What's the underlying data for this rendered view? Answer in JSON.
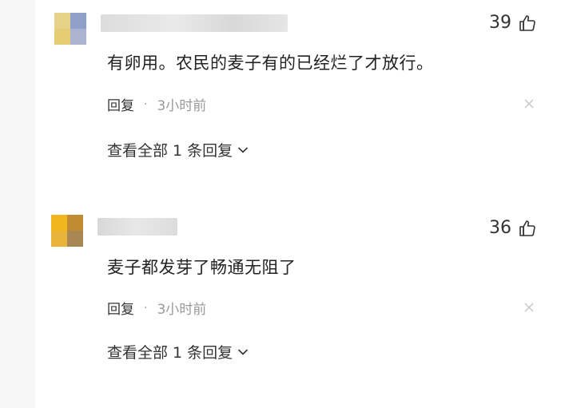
{
  "comments": [
    {
      "likes": "39",
      "text": "有卵用。农民的麦子有的已经烂了才放行。",
      "reply_label": "回复",
      "separator": "·",
      "time": "3小时前",
      "view_all": "查看全部 1 条回复",
      "avatar_colors": [
        "#e8d28a",
        "#8fa0c8",
        "#e5cd73",
        "#aab4cf"
      ]
    },
    {
      "likes": "36",
      "text": "麦子都发芽了畅通无阻了",
      "reply_label": "回复",
      "separator": "·",
      "time": "3小时前",
      "view_all": "查看全部 1 条回复",
      "avatar_colors": [
        "#f1b61d",
        "#c08b33",
        "#e9b43a",
        "#a88754"
      ]
    }
  ]
}
